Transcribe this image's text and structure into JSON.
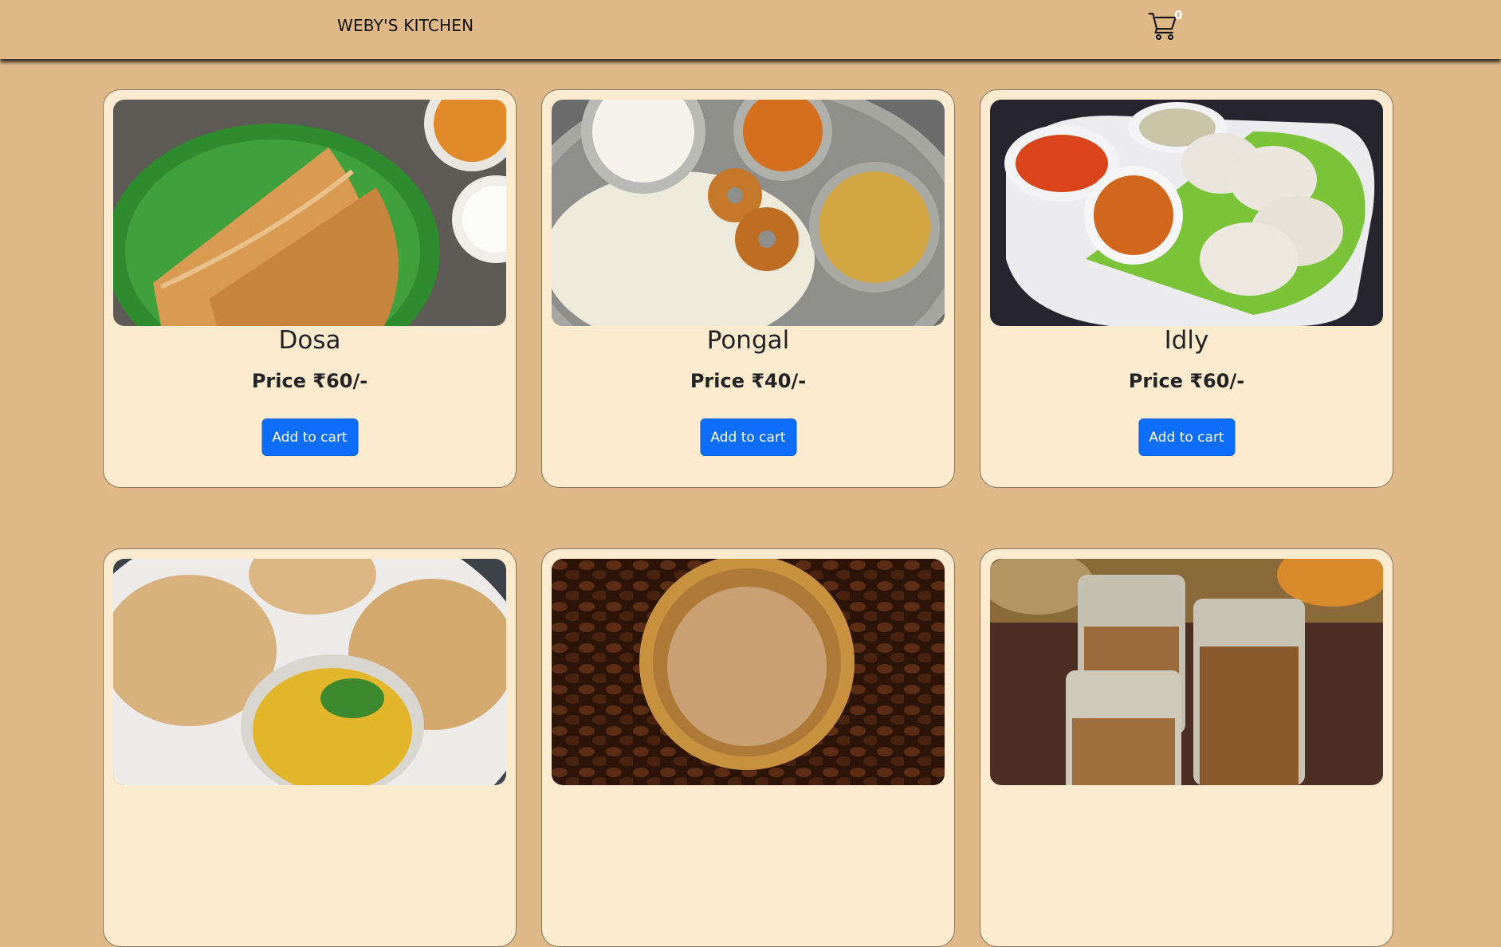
{
  "header": {
    "brand": "WEBY'S KITCHEN",
    "cart_count": "0",
    "cart_icon": "cart-icon"
  },
  "colors": {
    "background": "#deb887",
    "card": "#fdebd0",
    "button": "#0d6efd"
  },
  "products": [
    {
      "name": "Dosa",
      "price": "Price ₹60/-",
      "button": "Add to cart",
      "image": "dosa-photo"
    },
    {
      "name": "Pongal",
      "price": "Price ₹40/-",
      "button": "Add to cart",
      "image": "pongal-photo"
    },
    {
      "name": "Idly",
      "price": "Price ₹60/-",
      "button": "Add to cart",
      "image": "idly-photo"
    },
    {
      "name": "",
      "price": "",
      "button": "",
      "image": "poori-photo"
    },
    {
      "name": "",
      "price": "",
      "button": "",
      "image": "coffee-photo"
    },
    {
      "name": "",
      "price": "",
      "button": "",
      "image": "tea-photo"
    }
  ]
}
